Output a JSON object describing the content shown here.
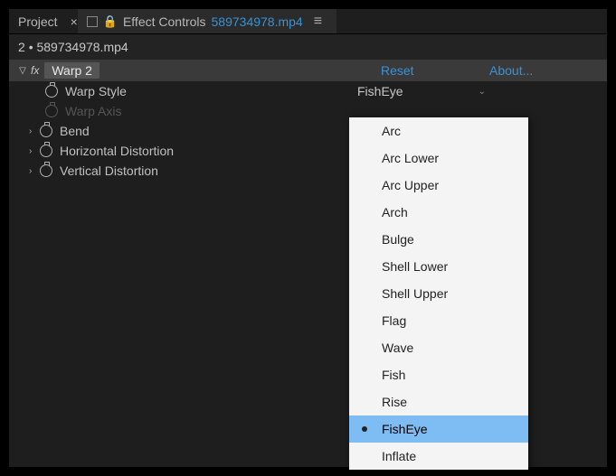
{
  "tabs": {
    "project_label": "Project",
    "effect_controls_label": "Effect Controls",
    "file_name": "589734978.mp4"
  },
  "breadcrumb": {
    "sequence": "2",
    "separator": "•",
    "clip": "589734978.mp4"
  },
  "effect": {
    "name": "Warp 2",
    "reset_label": "Reset",
    "about_label": "About...",
    "props": {
      "warp_style": {
        "label": "Warp Style",
        "value": "FishEye"
      },
      "warp_axis": {
        "label": "Warp Axis"
      },
      "bend": {
        "label": "Bend"
      },
      "hdist": {
        "label": "Horizontal Distortion"
      },
      "vdist": {
        "label": "Vertical Distortion"
      }
    }
  },
  "dropdown": {
    "options": [
      "Arc",
      "Arc Lower",
      "Arc Upper",
      "Arch",
      "Bulge",
      "Shell Lower",
      "Shell Upper",
      "Flag",
      "Wave",
      "Fish",
      "Rise",
      "FishEye",
      "Inflate"
    ],
    "selected": "FishEye"
  }
}
